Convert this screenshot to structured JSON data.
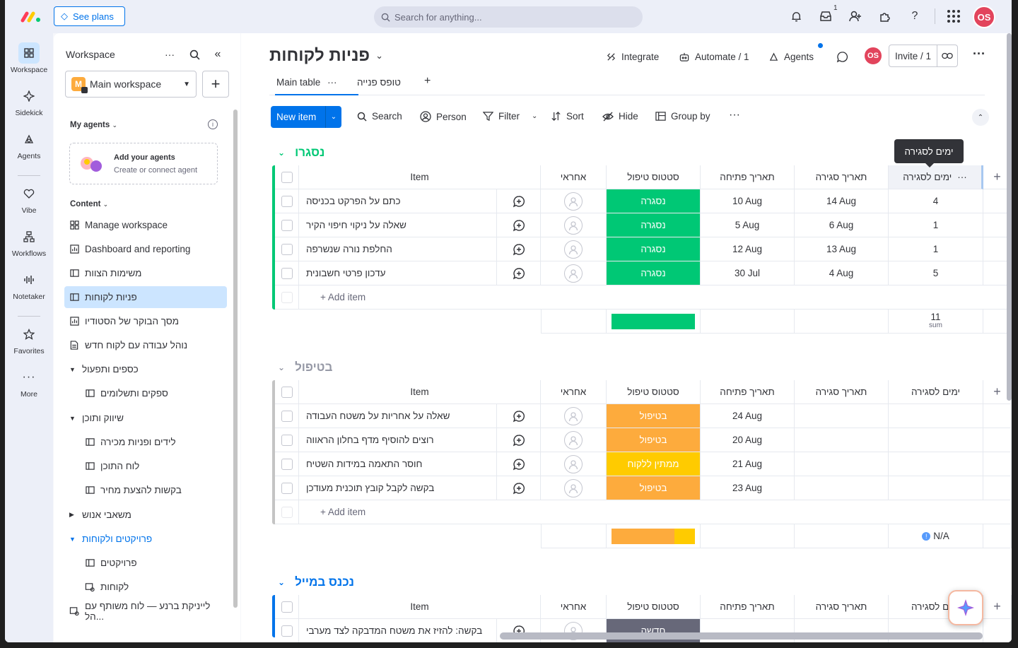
{
  "topbar": {
    "see_plans": "See plans",
    "search_placeholder": "Search for anything...",
    "inbox_count": "1",
    "avatar": "OS"
  },
  "rail": [
    {
      "label": "Workspace",
      "icon": "grid-icon"
    },
    {
      "label": "Sidekick",
      "icon": "sparkle-icon"
    },
    {
      "label": "Agents",
      "icon": "agents-icon"
    },
    {
      "label": "Vibe",
      "icon": "heart-icon"
    },
    {
      "label": "Workflows",
      "icon": "workflows-icon"
    },
    {
      "label": "Notetaker",
      "icon": "audio-icon"
    },
    {
      "label": "Favorites",
      "icon": "star-icon"
    },
    {
      "label": "More",
      "icon": "more-icon"
    }
  ],
  "sidebar": {
    "title": "Workspace",
    "workspace_name": "Main workspace",
    "workspace_badge": "M",
    "my_agents": "My agents",
    "add_agents_title": "Add your agents",
    "add_agents_sub": "Create or connect agent",
    "content": "Content",
    "items": [
      {
        "label": "Manage workspace"
      },
      {
        "label": "Dashboard and reporting"
      },
      {
        "label": "משימות הצוות"
      },
      {
        "label": "פניות לקוחות"
      },
      {
        "label": "מסך הבוקר של הסטודיו"
      },
      {
        "label": "נוהל עבודה עם לקוח חדש"
      },
      {
        "label": "כספים ותפעול"
      },
      {
        "label": "ספקים ותשלומים"
      },
      {
        "label": "שיווק ותוכן"
      },
      {
        "label": "לידים ופניות מכירה"
      },
      {
        "label": "לוח התוכן"
      },
      {
        "label": "בקשות להצעת מחיר"
      },
      {
        "label": "משאבי אנוש"
      },
      {
        "label": "פרויקטים ולקוחות"
      },
      {
        "label": "פרויקטים"
      },
      {
        "label": "לקוחות"
      },
      {
        "label": "לייניקת ברנע — לוח משותף עם הל..."
      }
    ]
  },
  "board": {
    "title": "פניות לקוחות",
    "integrate": "Integrate",
    "automate": "Automate / 1",
    "agents": "Agents",
    "invite": "Invite / 1",
    "tabs": [
      "Main table",
      "טופס פנייה"
    ],
    "toolbar": {
      "new_item": "New item",
      "search": "Search",
      "person": "Person",
      "filter": "Filter",
      "sort": "Sort",
      "hide": "Hide",
      "group_by": "Group by"
    },
    "tooltip": "ימים לסגירה",
    "columns": [
      "Item",
      "אחראי",
      "סטטוס טיפול",
      "תאריך פתיחה",
      "תאריך סגירה",
      "ימים לסגירה"
    ],
    "add_item": "+ Add item",
    "groups": [
      {
        "title": "נסגרו",
        "color": "#00c875",
        "rows": [
          {
            "item": "כתם על הפרקט בכניסה",
            "status": "נסגרה",
            "status_color": "#00c875",
            "open": "10 Aug",
            "close": "14 Aug",
            "days": "4"
          },
          {
            "item": "שאלה על ניקוי חיפוי הקיר",
            "status": "נסגרה",
            "status_color": "#00c875",
            "open": "5 Aug",
            "close": "6 Aug",
            "days": "1"
          },
          {
            "item": "החלפת נורה שנשרפה",
            "status": "נסגרה",
            "status_color": "#00c875",
            "open": "12 Aug",
            "close": "13 Aug",
            "days": "1"
          },
          {
            "item": "עדכון פרטי חשבונית",
            "status": "נסגרה",
            "status_color": "#00c875",
            "open": "30 Jul",
            "close": "4 Aug",
            "days": "5"
          }
        ],
        "summary": {
          "days_sum": "11",
          "sum_label": "sum",
          "status_bar": [
            {
              "color": "#00c875",
              "fraction": 1.0
            }
          ]
        }
      },
      {
        "title": "בטיפול",
        "color": "#c4c4c4",
        "rows": [
          {
            "item": "שאלה על אחריות על משטח העבודה",
            "status": "בטיפול",
            "status_color": "#fdab3d",
            "open": "24 Aug",
            "close": "",
            "days": ""
          },
          {
            "item": "רוצים להוסיף מדף בחלון הראווה",
            "status": "בטיפול",
            "status_color": "#fdab3d",
            "open": "20 Aug",
            "close": "",
            "days": ""
          },
          {
            "item": "חוסר התאמה במידות השטיח",
            "status": "ממתין ללקוח",
            "status_color": "#ffcb00",
            "open": "21 Aug",
            "close": "",
            "days": ""
          },
          {
            "item": "בקשה לקבל קובץ תוכנית מעודכן",
            "status": "בטיפול",
            "status_color": "#fdab3d",
            "open": "23 Aug",
            "close": "",
            "days": ""
          }
        ],
        "summary": {
          "days_sum": "N/A",
          "status_bar": [
            {
              "color": "#fdab3d",
              "fraction": 0.75
            },
            {
              "color": "#ffcb00",
              "fraction": 0.25
            }
          ]
        }
      },
      {
        "title": "נכנס במייל",
        "color": "#0073ea",
        "rows": [
          {
            "item": "בקשה: להזיז את משטח המדבקה לצד מערבי",
            "status": "חדשה",
            "status_color": "#676879",
            "open": "",
            "close": "",
            "days": ""
          }
        ]
      }
    ]
  }
}
